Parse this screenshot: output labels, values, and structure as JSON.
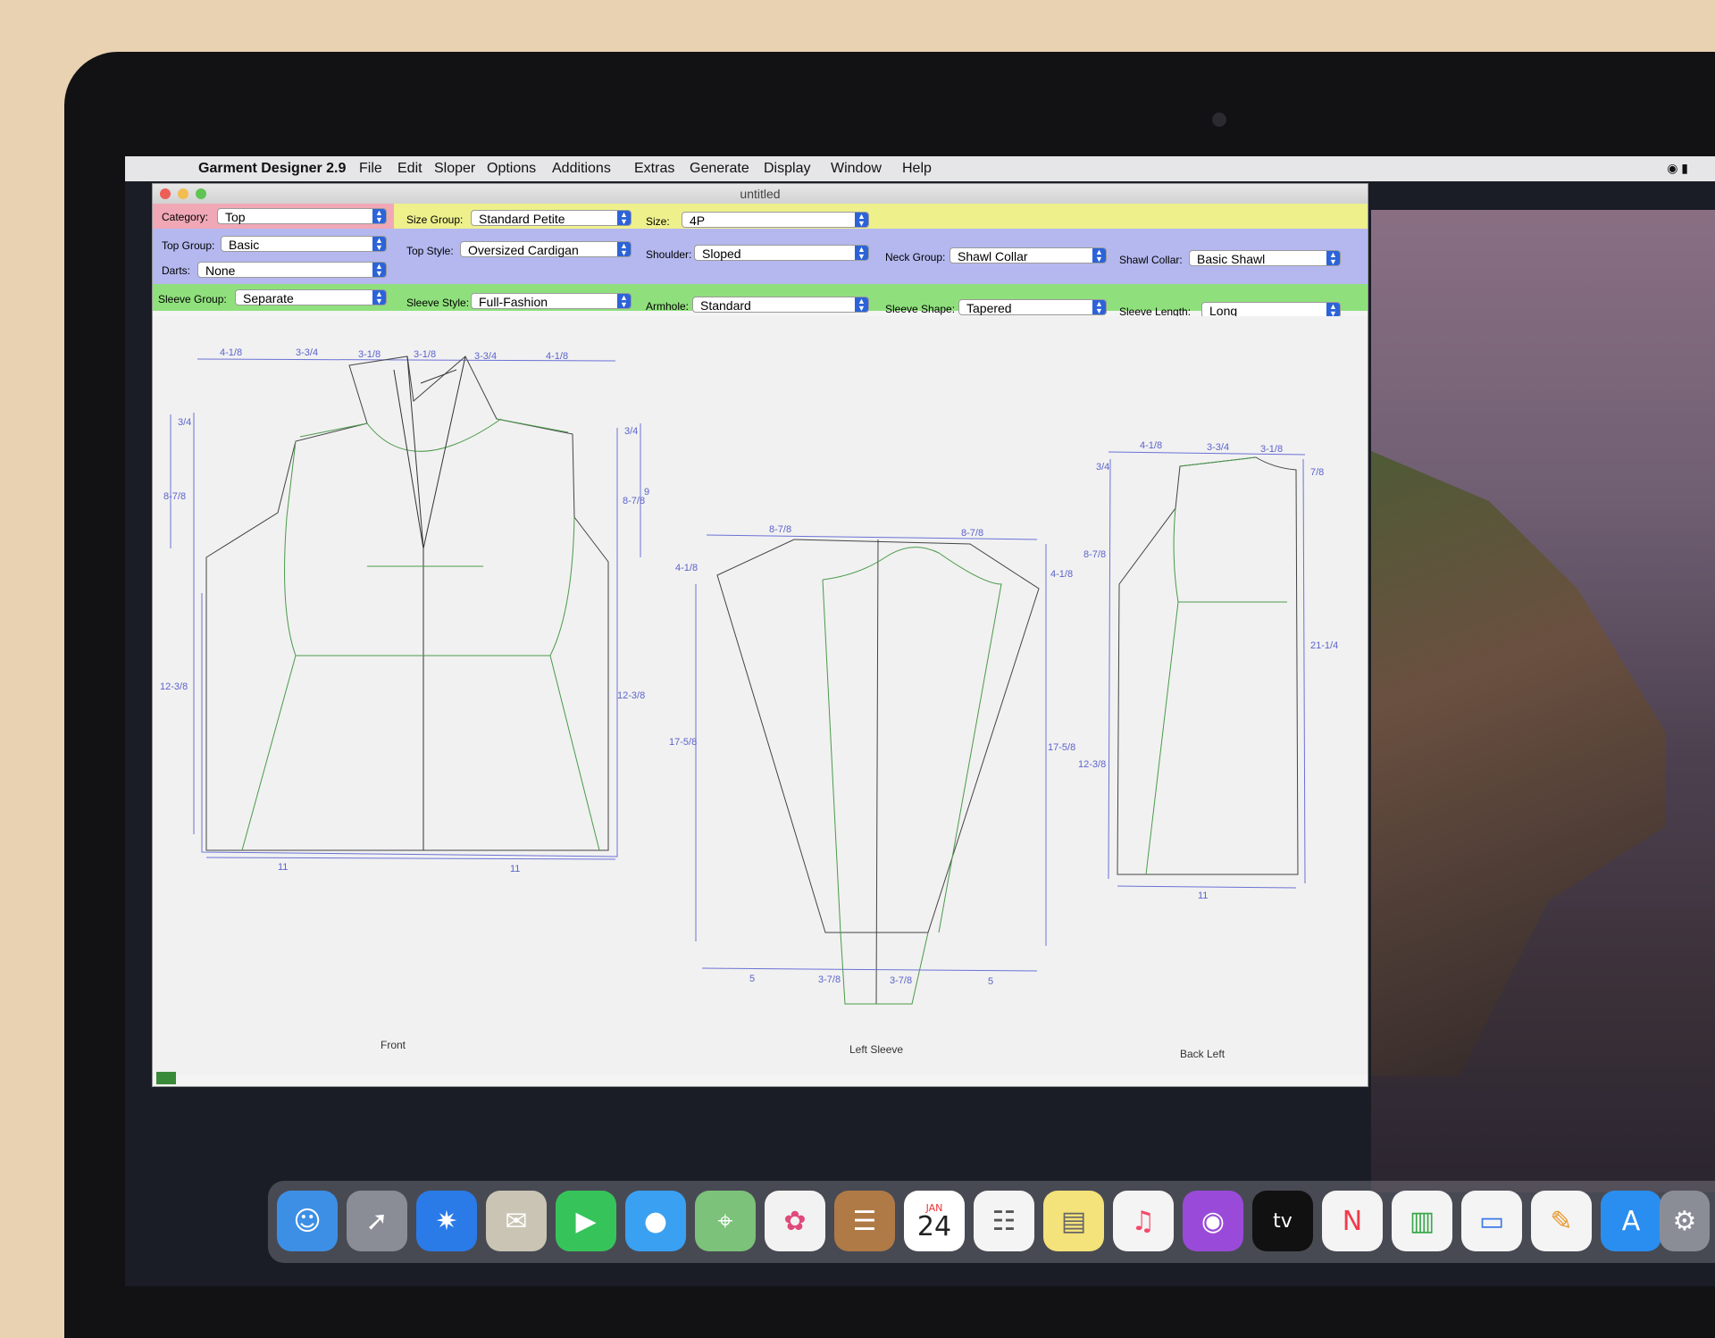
{
  "menubar": {
    "app_name": "Garment Designer 2.9",
    "items": [
      "File",
      "Edit",
      "Sloper",
      "Options",
      "Additions",
      "Extras",
      "Generate",
      "Display",
      "Window",
      "Help"
    ]
  },
  "window": {
    "title": "untitled",
    "category_label": "Category:",
    "category_value": "Top",
    "size_group_label": "Size Group:",
    "size_group_value": "Standard Petite",
    "size_label": "Size:",
    "size_value": "4P",
    "top_group_label": "Top Group:",
    "top_group_value": "Basic",
    "darts_label": "Darts:",
    "darts_value": "None",
    "top_style_label": "Top Style:",
    "top_style_value": "Oversized Cardigan",
    "shoulder_label": "Shoulder:",
    "shoulder_value": "Sloped",
    "neck_group_label": "Neck Group:",
    "neck_group_value": "Shawl Collar",
    "shawl_collar_label": "Shawl Collar:",
    "shawl_collar_value": "Basic Shawl",
    "sleeve_group_label": "Sleeve Group:",
    "sleeve_group_value": "Separate",
    "sleeve_style_label": "Sleeve Style:",
    "sleeve_style_value": "Full-Fashion",
    "armhole_label": "Armhole:",
    "armhole_value": "Standard",
    "sleeve_shape_label": "Sleeve Shape:",
    "sleeve_shape_value": "Tapered",
    "sleeve_length_label": "Sleeve Length:",
    "sleeve_length_value": "Long"
  },
  "pattern": {
    "front_label": "Front",
    "sleeve_label": "Left Sleeve",
    "back_label": "Back Left",
    "front_top_dims": [
      "4-1/8",
      "3-3/4",
      "3-1/8",
      "3-1/8",
      "3-3/4",
      "4-1/8"
    ],
    "front_left_dims": [
      "3/4",
      "8-7/8",
      "12-3/8"
    ],
    "front_right_dims": [
      "3/4",
      "8-7/8",
      "9",
      "12-3/8"
    ],
    "front_bottom_dims": [
      "11",
      "11"
    ],
    "sleeve_top_dims": [
      "8-7/8",
      "8-7/8"
    ],
    "sleeve_side_dims": [
      "4-1/8",
      "4-1/8",
      "17-5/8",
      "17-5/8"
    ],
    "sleeve_bottom_dims": [
      "5",
      "3-7/8",
      "3-7/8",
      "5"
    ],
    "back_top_dims": [
      "4-1/8",
      "3-3/4",
      "3-1/8"
    ],
    "back_side_dims": [
      "3/4",
      "7/8",
      "8-7/8",
      "21-1/4",
      "12-3/8"
    ],
    "back_bottom_dims": [
      "11"
    ]
  },
  "dock": {
    "calendar_month": "JAN",
    "calendar_day": "24",
    "tv_label": "tv"
  },
  "colors": {
    "blue_dim": "#6b72d6",
    "green_line": "#4a9a4a",
    "band_pink": "#f0a8b6",
    "band_yellow": "#eef08c",
    "band_blue": "#b4b8ef",
    "band_green": "#8fe07c"
  }
}
